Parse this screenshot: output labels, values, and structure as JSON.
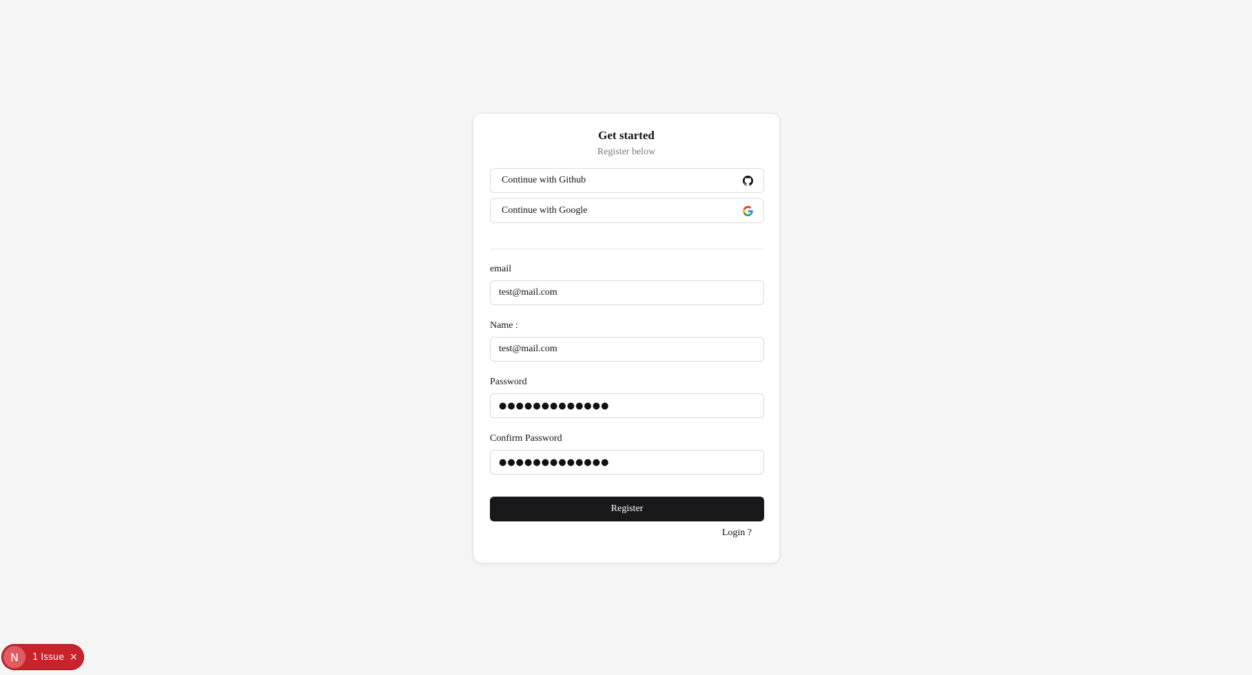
{
  "card": {
    "title": "Get started",
    "subtitle": "Register below"
  },
  "oauth": {
    "github_label": "Continue with Github",
    "google_label": "Continue with Google"
  },
  "form": {
    "email_label": "email",
    "email_value": "test@mail.com",
    "name_label": "Name :",
    "name_value": "test@mail.com",
    "password_label": "Password",
    "password_value": "●●●●●●●●●●●●●",
    "confirm_label": "Confirm Password",
    "confirm_value": "●●●●●●●●●●●●●",
    "register_label": "Register",
    "login_label": "Login ?"
  },
  "dev_badge": {
    "logo_letter": "N",
    "issue_text": "1 Issue",
    "close_icon": "×"
  },
  "colors": {
    "background": "#f5f5f5",
    "primary_button": "#18181b",
    "issue_badge": "#c8232c"
  }
}
